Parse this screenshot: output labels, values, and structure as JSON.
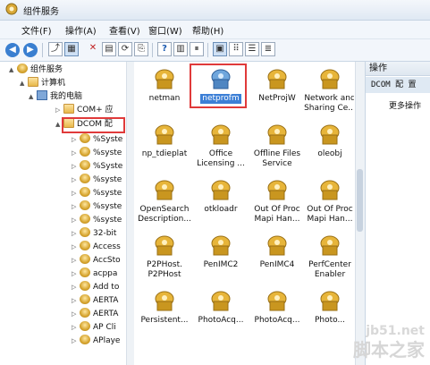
{
  "window": {
    "title": "组件服务"
  },
  "menubar": [
    "文件(F)",
    "操作(A)",
    "查看(V)",
    "窗口(W)",
    "帮助(H)"
  ],
  "tree": [
    {
      "label": "组件服务",
      "icon": "folder",
      "expander": "▲",
      "level": 0
    },
    {
      "label": "计算机",
      "icon": "folder",
      "expander": "▲",
      "level": 1
    },
    {
      "label": "我的电脑",
      "icon": "computer",
      "expander": "▲",
      "level": 2
    },
    {
      "label": "COM+ 应",
      "icon": "folder",
      "expander": "▷",
      "level": 3
    },
    {
      "label": "DCOM 配",
      "icon": "folder",
      "expander": "▲",
      "level": 3
    },
    {
      "label": "%Syste",
      "icon": "gear",
      "expander": "▷",
      "level": 4
    },
    {
      "label": "%syste",
      "icon": "gear",
      "expander": "▷",
      "level": 4
    },
    {
      "label": "%Syste",
      "icon": "gear",
      "expander": "▷",
      "level": 4
    },
    {
      "label": "%syste",
      "icon": "gear",
      "expander": "▷",
      "level": 4
    },
    {
      "label": "%syste",
      "icon": "gear",
      "expander": "▷",
      "level": 4
    },
    {
      "label": "%syste",
      "icon": "gear",
      "expander": "▷",
      "level": 4
    },
    {
      "label": "%syste",
      "icon": "gear",
      "expander": "▷",
      "level": 4
    },
    {
      "label": "32-bit",
      "icon": "gear",
      "expander": "▷",
      "level": 4
    },
    {
      "label": "Access",
      "icon": "gear",
      "expander": "▷",
      "level": 4
    },
    {
      "label": "AccSto",
      "icon": "gear",
      "expander": "▷",
      "level": 4
    },
    {
      "label": "acppa",
      "icon": "gear",
      "expander": "▷",
      "level": 4
    },
    {
      "label": "Add to",
      "icon": "gear",
      "expander": "▷",
      "level": 4
    },
    {
      "label": "AERTA",
      "icon": "gear",
      "expander": "▷",
      "level": 4
    },
    {
      "label": "AERTA",
      "icon": "gear",
      "expander": "▷",
      "level": 4
    },
    {
      "label": "AP Cli",
      "icon": "gear",
      "expander": "▷",
      "level": 4
    },
    {
      "label": "APlaye",
      "icon": "gear",
      "expander": "▷",
      "level": 4
    }
  ],
  "items": [
    {
      "label": "netman"
    },
    {
      "label": "netprofm",
      "selected": true
    },
    {
      "label": "NetProjW"
    },
    {
      "label": "Network and Sharing Ce..."
    },
    {
      "label": "np_tdieplat"
    },
    {
      "label": "Office Licensing ..."
    },
    {
      "label": "Offline Files Service"
    },
    {
      "label": "oleobj"
    },
    {
      "label": "OpenSearch Description..."
    },
    {
      "label": "otkloadr"
    },
    {
      "label": "Out Of Proc Mapi Han..."
    },
    {
      "label": "Out Of Proc Mapi Han..."
    },
    {
      "label": "P2PHost. P2PHost"
    },
    {
      "label": "PenIMC2"
    },
    {
      "label": "PenIMC4"
    },
    {
      "label": "PerfCenter Enabler"
    },
    {
      "label": "Persistent..."
    },
    {
      "label": "PhotoAcq..."
    },
    {
      "label": "PhotoAcq..."
    },
    {
      "label": "Photo..."
    }
  ],
  "actions": {
    "header": "操作",
    "section": "DCOM 配 置",
    "more": "更多操作"
  },
  "watermark": {
    "site": "jb51.net",
    "brand": "脚本之家"
  },
  "colors": {
    "highlight": "#e03a3a",
    "selected_bg": "#3c7fd6",
    "icon_gold": "#d4a22c"
  }
}
